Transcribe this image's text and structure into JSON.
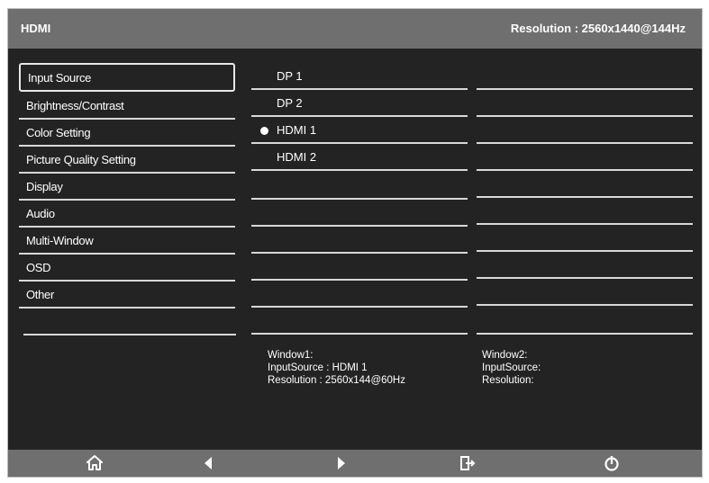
{
  "header": {
    "source": "HDMI",
    "resolution_label": "Resolution",
    "resolution_sep": ":",
    "resolution_value": "2560x1440@144Hz"
  },
  "menu": [
    {
      "label": "Input Source",
      "selected": true
    },
    {
      "label": "Brightness/Contrast"
    },
    {
      "label": "Color Setting"
    },
    {
      "label": "Picture Quality Setting"
    },
    {
      "label": "Display"
    },
    {
      "label": "Audio"
    },
    {
      "label": "Multi-Window"
    },
    {
      "label": "OSD"
    },
    {
      "label": "Other"
    }
  ],
  "options": [
    {
      "label": "DP 1",
      "selected": false
    },
    {
      "label": "DP 2",
      "selected": false
    },
    {
      "label": "HDMI 1",
      "selected": true
    },
    {
      "label": "HDMI 2",
      "selected": false
    }
  ],
  "window1": {
    "title": "Window1:",
    "input_line": "InputSource : HDMI 1",
    "resolution_line": "Resolution :  2560x144@60Hz"
  },
  "window2": {
    "title": "Window2:",
    "input_line": "InputSource:",
    "resolution_line": "Resolution:"
  },
  "footer": {
    "buttons": [
      "home-icon",
      "left-arrow-icon",
      "right-arrow-icon",
      "exit-icon",
      "power-icon"
    ]
  },
  "colors": {
    "background": "#232323",
    "bar": "#6f6f6f",
    "text": "#ffffff",
    "lines": "#d8d8d8"
  }
}
